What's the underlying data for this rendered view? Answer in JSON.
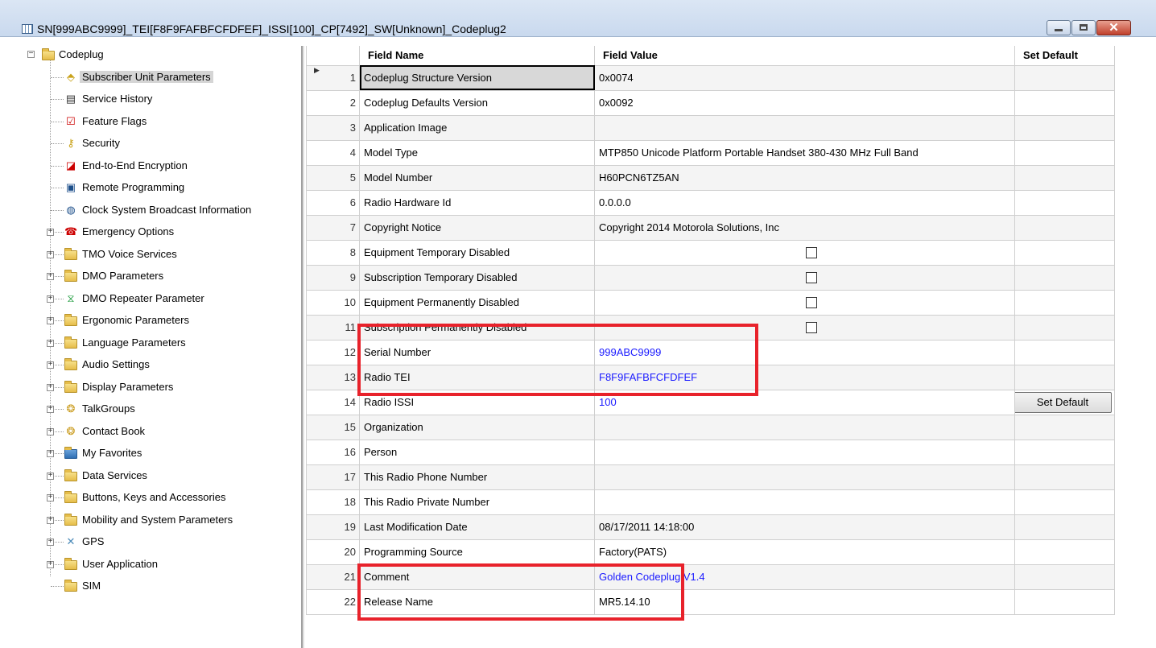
{
  "window": {
    "title": "SN[999ABC9999]_TEI[F8F9FAFBFCFDFEF]_ISSI[100]_CP[7492]_SW[Unknown]_Codeplug2",
    "min_glyph": "",
    "max_glyph": "",
    "close_glyph": "✕"
  },
  "tree": {
    "root": "Codeplug",
    "items": [
      {
        "label": "Subscriber Unit Parameters",
        "icon": "tag-icon",
        "expandable": false,
        "selected": true
      },
      {
        "label": "Service History",
        "icon": "document-icon",
        "expandable": false
      },
      {
        "label": "Feature Flags",
        "icon": "checklist-icon",
        "expandable": false
      },
      {
        "label": "Security",
        "icon": "key-icon",
        "expandable": false
      },
      {
        "label": "End-to-End Encryption",
        "icon": "encryption-icon",
        "expandable": false
      },
      {
        "label": "Remote Programming",
        "icon": "remote-programming-icon",
        "expandable": false
      },
      {
        "label": "Clock System Broadcast Information",
        "icon": "clock-icon",
        "expandable": false
      },
      {
        "label": "Emergency Options",
        "icon": "emergency-icon",
        "expandable": true
      },
      {
        "label": "TMO Voice Services",
        "icon": "folder-icon",
        "expandable": true
      },
      {
        "label": "DMO Parameters",
        "icon": "folder-icon",
        "expandable": true
      },
      {
        "label": "DMO Repeater Parameter",
        "icon": "repeater-icon",
        "expandable": true
      },
      {
        "label": "Ergonomic Parameters",
        "icon": "folder-icon",
        "expandable": true
      },
      {
        "label": "Language Parameters",
        "icon": "folder-icon",
        "expandable": true
      },
      {
        "label": "Audio Settings",
        "icon": "folder-icon",
        "expandable": true
      },
      {
        "label": "Display Parameters",
        "icon": "folder-icon",
        "expandable": true
      },
      {
        "label": "TalkGroups",
        "icon": "talkgroups-icon",
        "expandable": true
      },
      {
        "label": "Contact Book",
        "icon": "contact-book-icon",
        "expandable": true
      },
      {
        "label": "My Favorites",
        "icon": "favorites-folder-icon",
        "expandable": true
      },
      {
        "label": "Data Services",
        "icon": "folder-icon",
        "expandable": true
      },
      {
        "label": "Buttons, Keys and Accessories",
        "icon": "folder-icon",
        "expandable": true
      },
      {
        "label": "Mobility and System Parameters",
        "icon": "folder-icon",
        "expandable": true
      },
      {
        "label": "GPS",
        "icon": "satellite-icon",
        "expandable": true
      },
      {
        "label": "User Application",
        "icon": "folder-icon",
        "expandable": true
      },
      {
        "label": "SIM",
        "icon": "folder-icon",
        "expandable": false
      }
    ]
  },
  "grid": {
    "columns": {
      "field_name": "Field Name",
      "field_value": "Field Value",
      "set_default": "Set Default"
    },
    "current_row_marker": "▶",
    "rows": [
      {
        "n": "1",
        "name": "Codeplug Structure Version",
        "value": "0x0074"
      },
      {
        "n": "2",
        "name": "Codeplug Defaults Version",
        "value": "0x0092"
      },
      {
        "n": "3",
        "name": "Application Image",
        "value": ""
      },
      {
        "n": "4",
        "name": "Model Type",
        "value": "MTP850 Unicode Platform Portable Handset 380-430 MHz Full Band"
      },
      {
        "n": "5",
        "name": "Model Number",
        "value": "H60PCN6TZ5AN"
      },
      {
        "n": "6",
        "name": "Radio Hardware Id",
        "value": "0.0.0.0"
      },
      {
        "n": "7",
        "name": "Copyright Notice",
        "value": "Copyright 2014 Motorola Solutions, Inc"
      },
      {
        "n": "8",
        "name": "Equipment Temporary Disabled",
        "checkbox": true
      },
      {
        "n": "9",
        "name": "Subscription Temporary Disabled",
        "checkbox": true
      },
      {
        "n": "10",
        "name": "Equipment Permanently Disabled",
        "checkbox": true
      },
      {
        "n": "11",
        "name": "Subscription Permanently Disabled",
        "checkbox": true
      },
      {
        "n": "12",
        "name": "Serial Number",
        "value": "999ABC9999",
        "blue": true
      },
      {
        "n": "13",
        "name": "Radio TEI",
        "value": "F8F9FAFBFCFDFEF",
        "blue": true
      },
      {
        "n": "14",
        "name": "Radio ISSI",
        "value": "100",
        "blue": true,
        "button": "Set Default"
      },
      {
        "n": "15",
        "name": "Organization",
        "value": ""
      },
      {
        "n": "16",
        "name": "Person",
        "value": ""
      },
      {
        "n": "17",
        "name": "This Radio Phone Number",
        "value": ""
      },
      {
        "n": "18",
        "name": "This Radio Private Number",
        "value": ""
      },
      {
        "n": "19",
        "name": "Last Modification Date",
        "value": "08/17/2011 14:18:00"
      },
      {
        "n": "20",
        "name": "Programming Source",
        "value": "Factory(PATS)"
      },
      {
        "n": "21",
        "name": "Comment",
        "value": "Golden Codeplug V1.4",
        "blue": true
      },
      {
        "n": "22",
        "name": "Release Name",
        "value": "MR5.14.10"
      }
    ]
  },
  "annotation_color": "#e8222b"
}
